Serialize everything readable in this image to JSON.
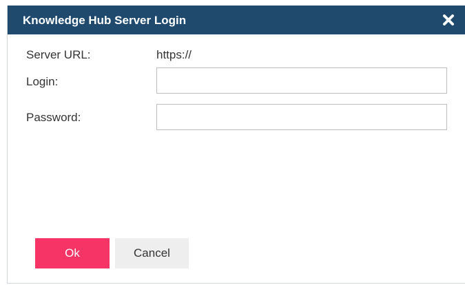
{
  "dialog": {
    "title": "Knowledge Hub Server Login",
    "close_icon": "close-icon",
    "colors": {
      "titlebar": "#1f4a6e",
      "ok_button": "#f73466",
      "cancel_button": "#eeeeee"
    }
  },
  "form": {
    "server_url_label": "Server URL:",
    "server_url_value": "https://",
    "login_label": "Login:",
    "login_value": "",
    "password_label": "Password:",
    "password_value": ""
  },
  "buttons": {
    "ok_label": "Ok",
    "cancel_label": "Cancel"
  }
}
